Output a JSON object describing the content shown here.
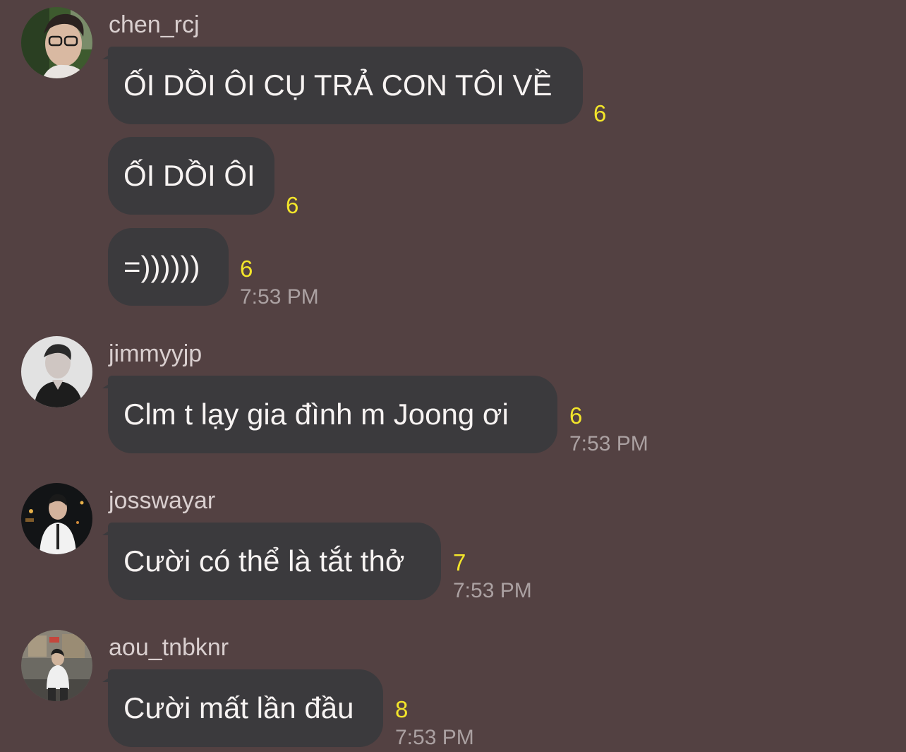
{
  "colors": {
    "background": "#534142",
    "bubble": "#3b3a3d",
    "message_text": "#f7f3f2",
    "username": "#d9cfcf",
    "read_count": "#f3e52a",
    "timestamp": "#aba1a2"
  },
  "groups": [
    {
      "username": "chen_rcj",
      "messages": [
        {
          "text": "ỐI DỒI ÔI CỤ TRẢ CON TÔI VỀ",
          "count": "6"
        },
        {
          "text": "ỐI DỒI ÔI",
          "count": "6"
        },
        {
          "text": "=))))))",
          "count": "6",
          "time": "7:53 PM"
        }
      ]
    },
    {
      "username": "jimmyyjp",
      "messages": [
        {
          "text": "Clm t lạy gia đình m Joong ơi",
          "count": "6",
          "time": "7:53 PM"
        }
      ]
    },
    {
      "username": "josswayar",
      "messages": [
        {
          "text": "Cười có thể là tắt thở",
          "count": "7",
          "time": "7:53 PM"
        }
      ]
    },
    {
      "username": "aou_tnbknr",
      "messages": [
        {
          "text": "Cười mất lần đầu",
          "count": "8",
          "time": "7:53 PM"
        }
      ]
    }
  ]
}
